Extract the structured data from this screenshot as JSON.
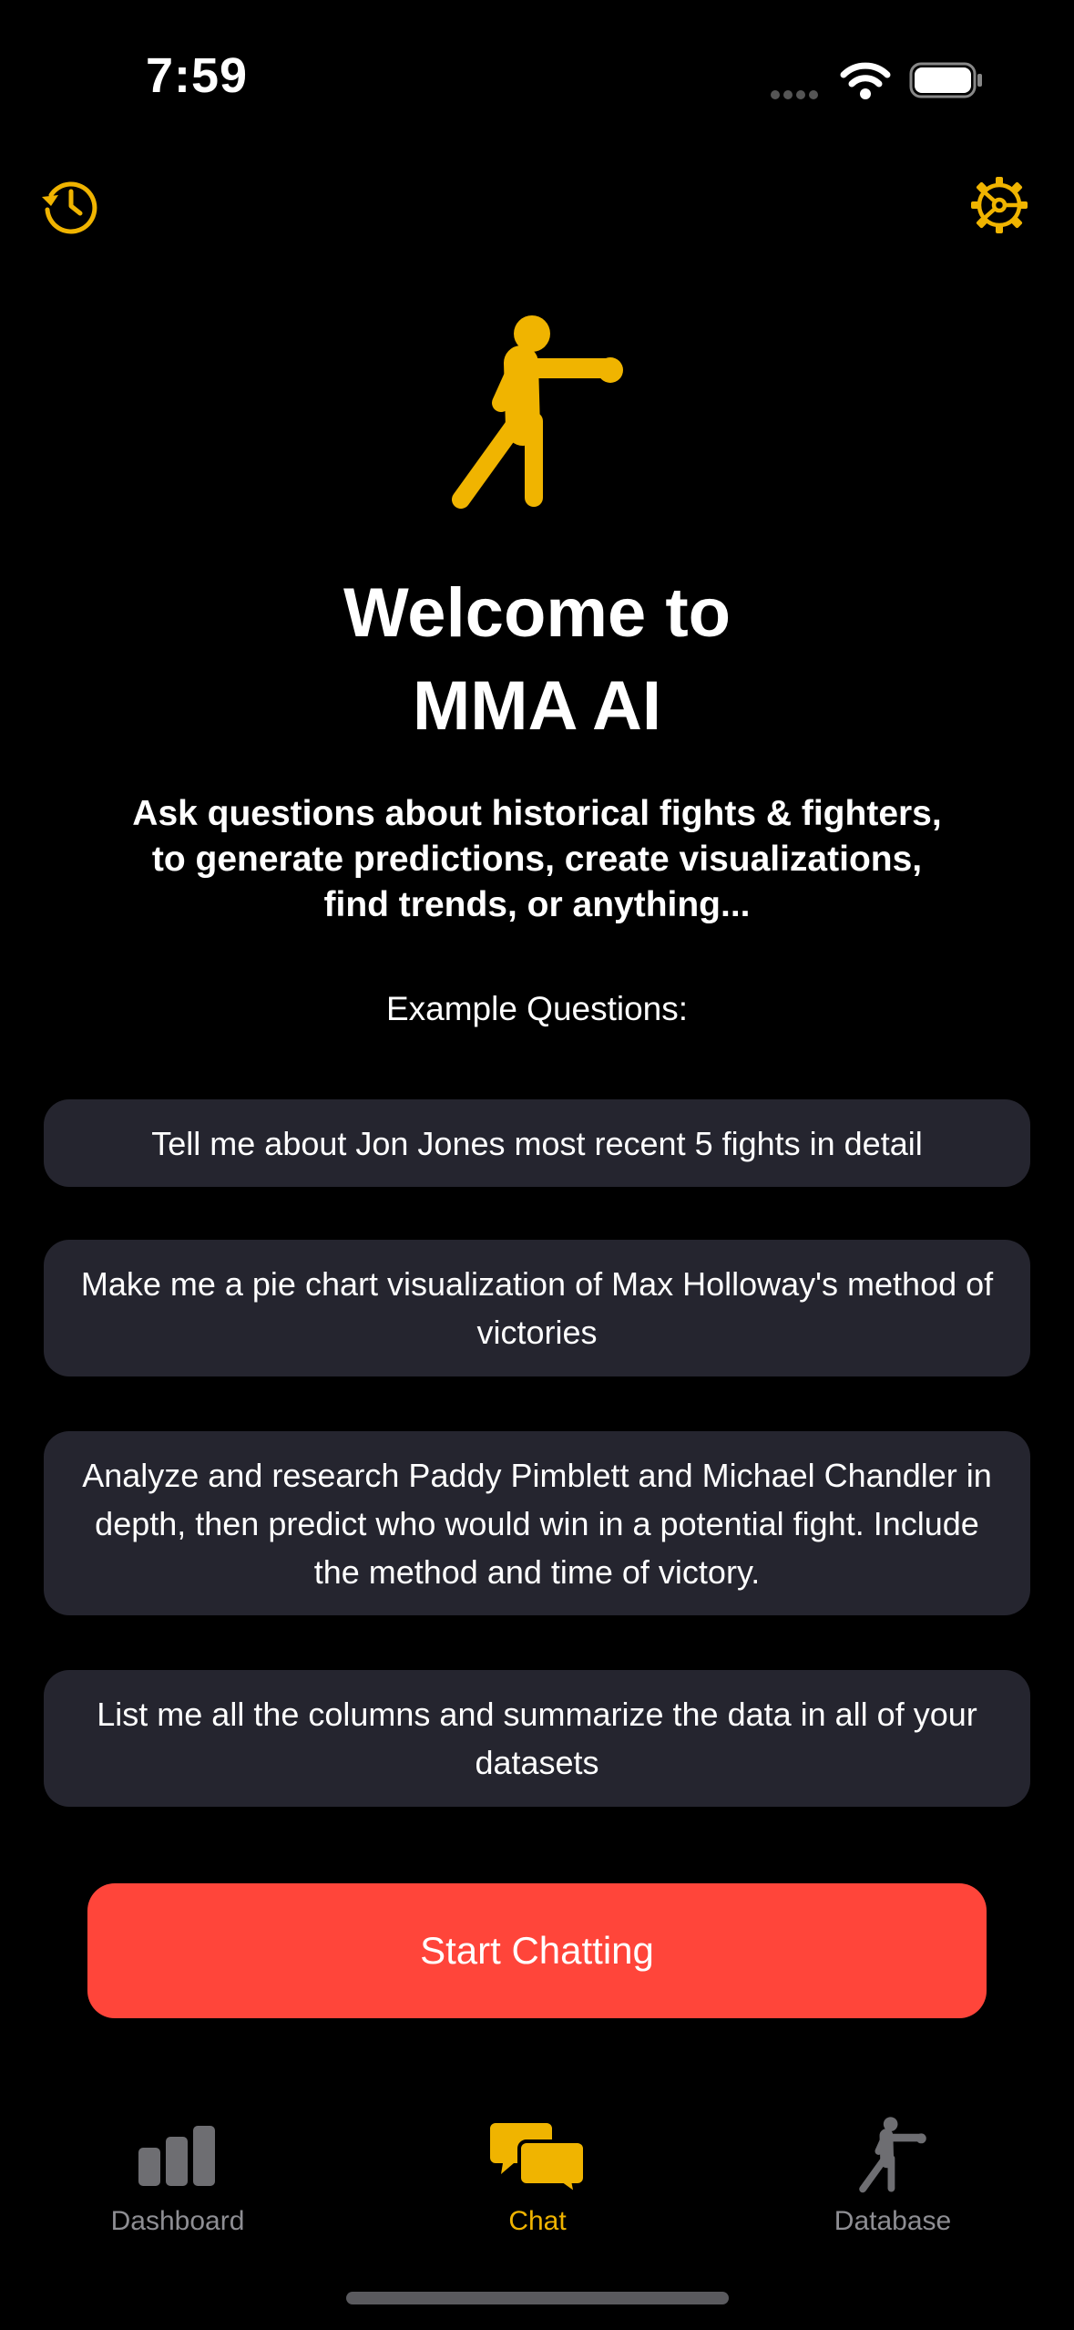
{
  "status_bar": {
    "time": "7:59"
  },
  "header": {
    "history_icon": "history-icon",
    "settings_icon": "gear-icon"
  },
  "hero": {
    "icon": "fighter-icon",
    "title_line1": "Welcome to",
    "title_line2": "MMA AI",
    "subtitle_line1": "Ask questions about historical fights & fighters,",
    "subtitle_line2": "to generate predictions, create visualizations,",
    "subtitle_line3": "find trends, or anything..."
  },
  "examples": {
    "label": "Example Questions:",
    "items": [
      "Tell me about Jon Jones most recent 5 fights in detail",
      "Make me a pie chart visualization of Max Holloway's method of victories",
      "Analyze and research Paddy Pimblett and Michael Chandler in depth, then predict who would win in a potential fight. Include the method and time of victory.",
      "List me all the columns and summarize the data in all of your datasets"
    ]
  },
  "start_button": {
    "label": "Start Chatting"
  },
  "tab_bar": {
    "items": [
      {
        "label": "Dashboard",
        "icon": "bar-chart-icon",
        "active": false
      },
      {
        "label": "Chat",
        "icon": "chat-bubbles-icon",
        "active": true
      },
      {
        "label": "Database",
        "icon": "fighter-icon",
        "active": false
      }
    ]
  },
  "colors": {
    "accent": "#f0b400",
    "button": "#ff453a",
    "card": "#25252f",
    "inactive": "#8e8e93"
  }
}
